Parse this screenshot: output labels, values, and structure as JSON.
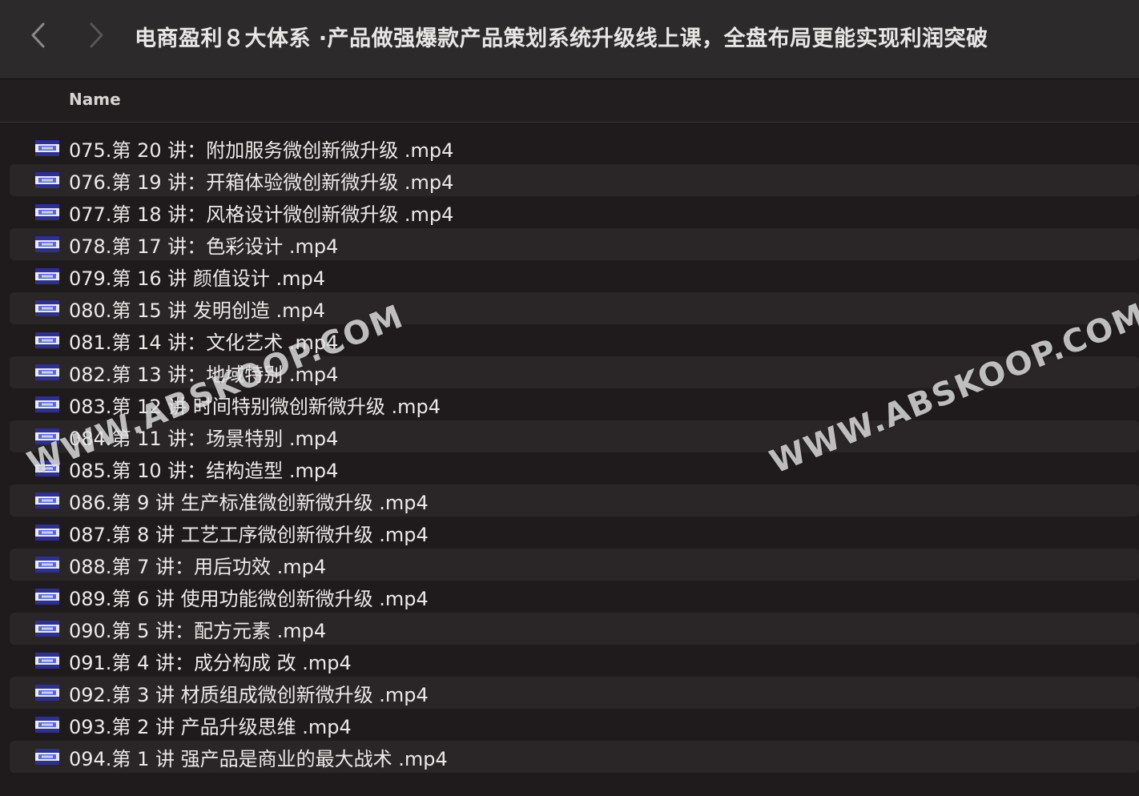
{
  "window": {
    "title": "电商盈利８大体系 ·产品做强爆款产品策划系统升级线上课，全盘布局更能实现利润突破"
  },
  "toolbar": {
    "back_icon": "chevron-left-icon",
    "forward_icon": "chevron-right-icon"
  },
  "list_header": {
    "name_column": "Name"
  },
  "files": [
    {
      "name": "075.第 20 讲：附加服务微创新微升级 .mp4",
      "icon": "video-file-icon"
    },
    {
      "name": "076.第 19 讲：开箱体验微创新微升级 .mp4",
      "icon": "video-file-icon"
    },
    {
      "name": "077.第 18 讲：风格设计微创新微升级 .mp4",
      "icon": "video-file-icon"
    },
    {
      "name": "078.第 17 讲：色彩设计 .mp4",
      "icon": "video-file-icon"
    },
    {
      "name": "079.第 16 讲 颜值设计 .mp4",
      "icon": "video-file-icon"
    },
    {
      "name": "080.第 15 讲 发明创造 .mp4",
      "icon": "video-file-icon"
    },
    {
      "name": "081.第 14 讲：文化艺术 .mp4",
      "icon": "video-file-icon"
    },
    {
      "name": "082.第 13 讲：地域特别 .mp4",
      "icon": "video-file-icon"
    },
    {
      "name": "083.第 12 讲 时间特别微创新微升级 .mp4",
      "icon": "video-file-icon"
    },
    {
      "name": "084.第 11 讲：场景特别 .mp4",
      "icon": "video-file-icon"
    },
    {
      "name": "085.第 10 讲：结构造型 .mp4",
      "icon": "video-file-icon"
    },
    {
      "name": "086.第 9 讲 生产标准微创新微升级 .mp4",
      "icon": "video-file-icon"
    },
    {
      "name": "087.第 8 讲 工艺工序微创新微升级 .mp4",
      "icon": "video-file-icon"
    },
    {
      "name": "088.第 7 讲：用后功效 .mp4",
      "icon": "video-file-icon"
    },
    {
      "name": "089.第 6 讲 使用功能微创新微升级 .mp4",
      "icon": "video-file-icon"
    },
    {
      "name": "090.第 5 讲：配方元素 .mp4",
      "icon": "video-file-icon"
    },
    {
      "name": "091.第 4 讲：成分构成 改 .mp4",
      "icon": "video-file-icon"
    },
    {
      "name": "092.第 3 讲 材质组成微创新微升级 .mp4",
      "icon": "video-file-icon"
    },
    {
      "name": "093.第 2 讲 产品升级思维 .mp4",
      "icon": "video-file-icon"
    },
    {
      "name": "094.第 1 讲 强产品是商业的最大战术 .mp4",
      "icon": "video-file-icon"
    }
  ],
  "watermark": {
    "text": "WWW.ABSKOOP.COM"
  },
  "colors": {
    "toolbar_bg": "#2c2a2b",
    "list_bg": "#1f1b1c",
    "row_alt_bg": "#2a2627",
    "text": "#ece9e9",
    "icon_accent": "#3b3fb0"
  }
}
